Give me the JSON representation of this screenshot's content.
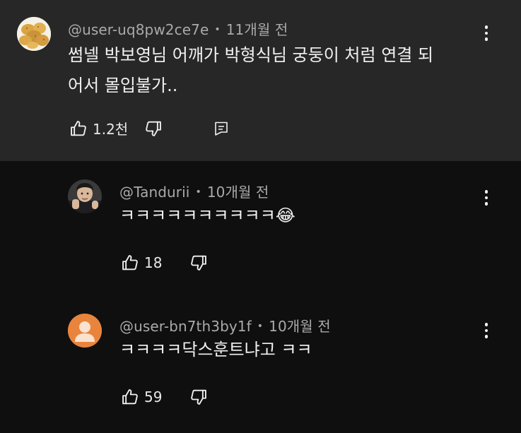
{
  "comments": [
    {
      "author": "@user-uq8pw2ce7e",
      "time": "11개월 전",
      "text": "썸넬 박보영님 어깨가 박형식님 궁둥이 처럼 연결 되\n어서 몰입불가..",
      "likes": "1.2천",
      "avatar_icon": "potatoes-avatar"
    },
    {
      "author": "@Tandurii",
      "time": "10개월 전",
      "text": "ㅋㅋㅋㅋㅋㅋㅋㅋㅋㅋ😂",
      "likes": "18",
      "avatar_icon": "photo-avatar"
    },
    {
      "author": "@user-bn7th3by1f",
      "time": "10개월 전",
      "text": "ㅋㅋㅋㅋ닥스훈트냐고 ㅋㅋ",
      "likes": "59",
      "avatar_icon": "default-user-avatar"
    }
  ],
  "colors": {
    "highlight_bg": "#272727",
    "page_bg": "#0f0f0f",
    "meta_text": "#aaaaaa",
    "default_avatar": "#e9843d"
  }
}
